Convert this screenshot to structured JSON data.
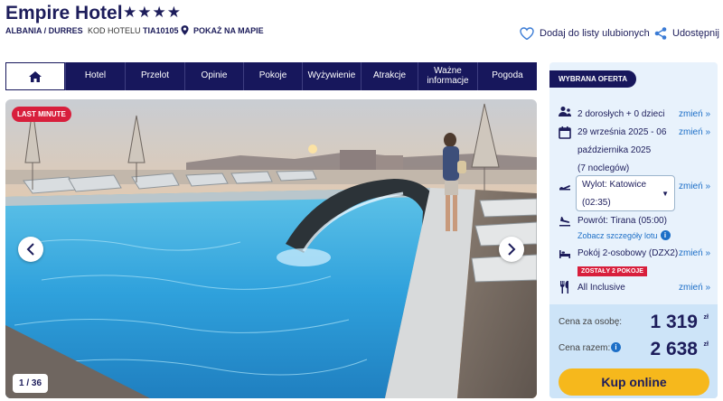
{
  "hotel": {
    "name": "Empire Hotel",
    "stars": "★★★★",
    "location": "ALBANIA / DURRES",
    "code_label": "KOD HOTELU",
    "code": "TIA10105",
    "map_link": "POKAŻ NA MAPIE"
  },
  "actions": {
    "favorite": "Dodaj do listy ulubionych",
    "share": "Udostępnij"
  },
  "nav": {
    "home_icon": "home-icon",
    "items": [
      "Hotel",
      "Przelot",
      "Opinie",
      "Pokoje",
      "Wyżywienie",
      "Atrakcje",
      "Ważne informacje",
      "Pogoda"
    ]
  },
  "gallery": {
    "badge": "LAST MINUTE",
    "counter": "1 / 36"
  },
  "offer": {
    "title": "WYBRANA OFERTA",
    "travelers": "2 dorosłych + 0 dzieci",
    "dates_line1": "29 września 2025 - 06",
    "dates_line2": "października 2025",
    "nights": "(7 noclegów)",
    "departure_line1": "Wylot: Katowice",
    "departure_line2": "(02:35)",
    "return": "Powrót: Tirana (05:00)",
    "flight_details": "Zobacz szczegóły lotu",
    "room": "Pokój 2-osobowy (DZX2)",
    "rooms_left": "ZOSTAŁY 2 POKOJE",
    "board": "All Inclusive",
    "change": "zmień »"
  },
  "price": {
    "per_person_label": "Cena za osobę:",
    "per_person": "1 319",
    "total_label": "Cena razem:",
    "total": "2 638",
    "currency": "zł",
    "buy": "Kup online"
  },
  "colors": {
    "navy": "#17175c",
    "accent_red": "#d81f3c",
    "cta_yellow": "#f6b81c",
    "link_blue": "#1d6fc7"
  }
}
